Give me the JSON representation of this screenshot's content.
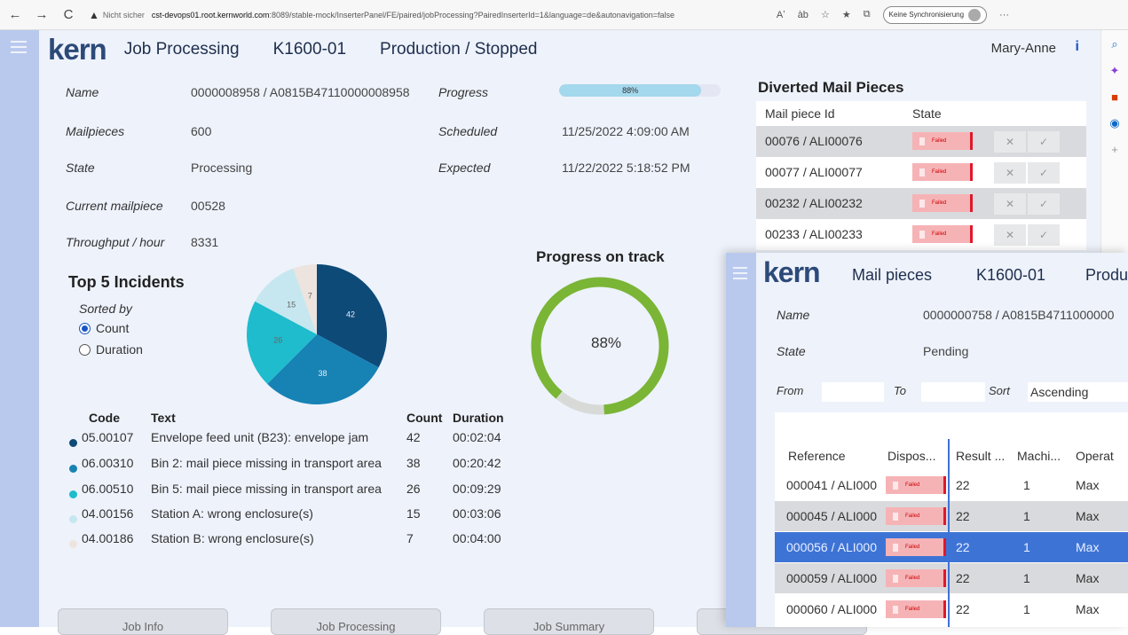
{
  "browser": {
    "back": "←",
    "forward": "→",
    "reload": "C",
    "security_label": "Nicht sicher",
    "url_host": "cst-devops01.root.kernworld.com",
    "url_rest": ":8089/stable-mock/InserterPanel/FE/paired/jobProcessing?PairedInserterId=1&language=de&autonavigation=false",
    "sync_label": "Keine Synchronisierung",
    "more": "···",
    "icons": [
      "read-aloud-icon",
      "translate-icon",
      "favorite-icon",
      "favorites-icon",
      "collections-icon"
    ],
    "icon_glyphs": [
      "Aʼ",
      "àb",
      "☆",
      "★",
      "⧉"
    ]
  },
  "edge_sidebar": {
    "glyphs": [
      "⌕",
      "✦",
      "■",
      "◉",
      "+"
    ]
  },
  "header": {
    "logo": "kern",
    "title": "Job Processing",
    "machine": "K1600-01",
    "status": "Production / Stopped",
    "user": "Mary-Anne",
    "info_glyph": "i"
  },
  "job": {
    "name_label": "Name",
    "name_value": "0000008958 / A0815B47110000008958",
    "mailpieces_label": "Mailpieces",
    "mailpieces_value": "600",
    "state_label": "State",
    "state_value": "Processing",
    "current_label": "Current mailpiece",
    "current_value": "00528",
    "throughput_label": "Throughput / hour",
    "throughput_value": "8331",
    "progress_label": "Progress",
    "progress_value": "88%",
    "progress_fraction": 0.88,
    "scheduled_label": "Scheduled",
    "scheduled_value": "11/25/2022 4:09:00 AM",
    "expected_label": "Expected",
    "expected_value": "11/22/2022 5:18:52 PM"
  },
  "incidents": {
    "title": "Top 5 Incidents",
    "sorted_by": "Sorted by",
    "sort_count": "Count",
    "sort_duration": "Duration",
    "col_code": "Code",
    "col_text": "Text",
    "col_count": "Count",
    "col_duration": "Duration",
    "rows": [
      {
        "code": "05.00107",
        "text": "Envelope feed unit (B23): envelope jam",
        "count": "42",
        "duration": "00:02:04",
        "color": "#0d4a78"
      },
      {
        "code": "06.00310",
        "text": "Bin 2: mail piece missing in transport area",
        "count": "38",
        "duration": "00:20:42",
        "color": "#1782b4"
      },
      {
        "code": "06.00510",
        "text": "Bin 5: mail piece missing in transport area",
        "count": "26",
        "duration": "00:09:29",
        "color": "#1ebccd"
      },
      {
        "code": "04.00156",
        "text": "Station A: wrong enclosure(s)",
        "count": "15",
        "duration": "00:03:06",
        "color": "#c6e7ef"
      },
      {
        "code": "04.00186",
        "text": "Station B: wrong enclosure(s)",
        "count": "7",
        "duration": "00:04:00",
        "color": "#ede4df"
      }
    ]
  },
  "gauge": {
    "title": "Progress on track",
    "value_label": "88%",
    "fraction": 0.88,
    "color": "#7ab536",
    "track_color": "#d8dad7"
  },
  "bottom_buttons": [
    "Job Info",
    "Job Processing",
    "Job Summary",
    ""
  ],
  "diverted": {
    "title": "Diverted Mail Pieces",
    "col_id": "Mail piece Id",
    "col_state": "State",
    "failed": "Failed",
    "reject_glyph": "✕",
    "accept_glyph": "✓",
    "rows": [
      "00076 / ALI00076",
      "00077 / ALI00077",
      "00232 / ALI00232",
      "00233 / ALI00233"
    ]
  },
  "overlay": {
    "logo": "kern",
    "title": "Mail pieces",
    "machine": "K1600-01",
    "status": "Produ",
    "name_label": "Name",
    "name_value": "0000000758 / A0815B4711000000",
    "state_label": "State",
    "state_value": "Pending",
    "from_label": "From",
    "to_label": "To",
    "sort_label": "Sort",
    "sort_value": "Ascending",
    "failed": "Failed",
    "cols": [
      "Reference",
      "Dispos...",
      "Result ...",
      "Machi...",
      "Operat"
    ],
    "rows": [
      {
        "ref": "000041 / ALI000",
        "result": "22",
        "machine": "1",
        "operator": "Max"
      },
      {
        "ref": "000045 / ALI000",
        "result": "22",
        "machine": "1",
        "operator": "Max"
      },
      {
        "ref": "000056 / ALI000",
        "result": "22",
        "machine": "1",
        "operator": "Max"
      },
      {
        "ref": "000059 / ALI000",
        "result": "22",
        "machine": "1",
        "operator": "Max"
      },
      {
        "ref": "000060 / ALI000",
        "result": "22",
        "machine": "1",
        "operator": "Max"
      }
    ]
  }
}
